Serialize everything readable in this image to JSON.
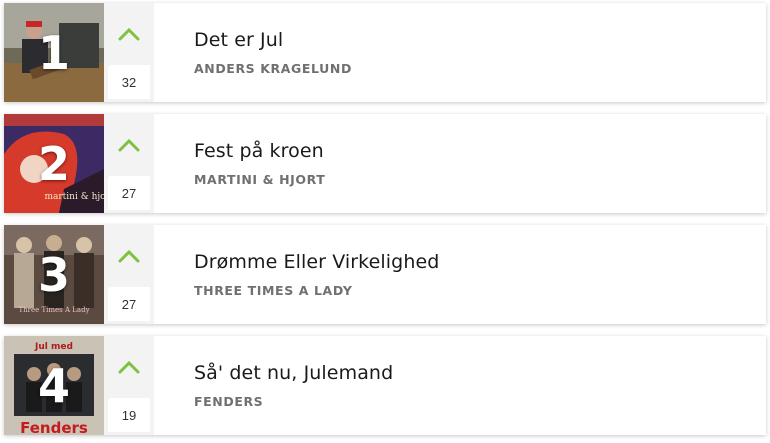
{
  "accent_color": "#7fc241",
  "chart": [
    {
      "rank": "1",
      "title": "Det er Jul",
      "artist": "ANDERS KRAGELUND",
      "votes": "32",
      "cover_text": ""
    },
    {
      "rank": "2",
      "title": "Fest på kroen",
      "artist": "MARTINI & HJORT",
      "votes": "27",
      "cover_text": "martini & hjort"
    },
    {
      "rank": "3",
      "title": "Drømme Eller Virkelighed",
      "artist": "THREE TIMES A LADY",
      "votes": "27",
      "cover_text": "Three Times A Lady"
    },
    {
      "rank": "4",
      "title": "Så' det nu, Julemand",
      "artist": "FENDERS",
      "votes": "19",
      "cover_text": "Jul med Fenders"
    }
  ]
}
